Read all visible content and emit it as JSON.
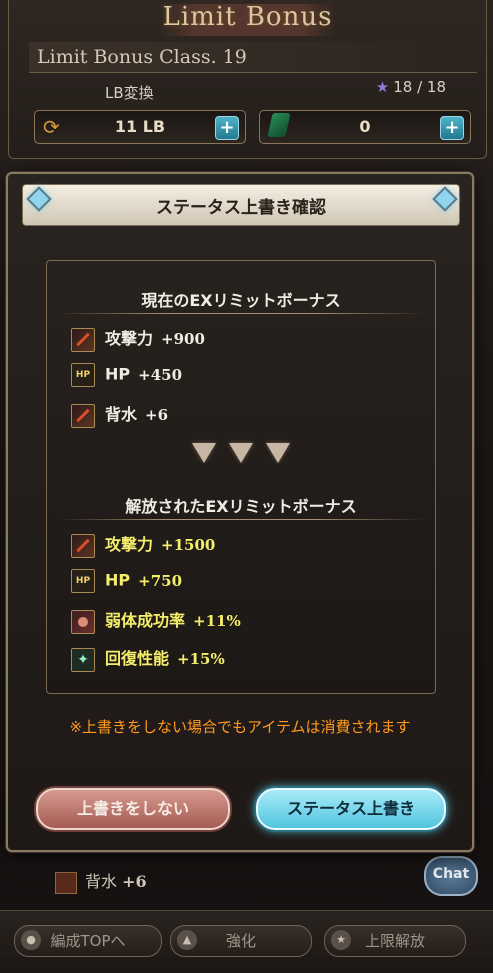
{
  "background": {
    "limit_bonus_title": "Limit Bonus",
    "class_label": "Limit Bonus Class. 19",
    "lb_convert_label": "LB変換",
    "star_count": "18 / 18",
    "lb_points": "11 LB",
    "gem_count": "0",
    "under_stat_label": "背水",
    "under_stat_value": "+6",
    "chat_label": "Chat",
    "nav": {
      "party_top": "編成TOPへ",
      "enhance": "強化",
      "uncap": "上限解放"
    }
  },
  "dialog": {
    "title": "ステータス上書き確認",
    "current_section_title": "現在のEXリミットボーナス",
    "current_stats": [
      {
        "icon": "attack-icon",
        "label": "攻撃力",
        "value": "+900"
      },
      {
        "icon": "hp-icon",
        "label": "HP",
        "value": "+450"
      },
      {
        "icon": "attack-icon",
        "label": "背水",
        "value": "+6"
      }
    ],
    "released_section_title": "解放されたEXリミットボーナス",
    "released_stats": [
      {
        "icon": "attack-icon",
        "label": "攻撃力",
        "value": "+1500"
      },
      {
        "icon": "hp-icon",
        "label": "HP",
        "value": "+750"
      },
      {
        "icon": "debuff-icon",
        "label": "弱体成功率",
        "value": "+11%"
      },
      {
        "icon": "heal-icon",
        "label": "回復性能",
        "value": "+15%"
      }
    ],
    "notice": "※上書きをしない場合でもアイテムは消費されます",
    "cancel_button": "上書きをしない",
    "confirm_button": "ステータス上書き"
  },
  "colors": {
    "notice": "#ff9a1e",
    "released_stat_text": "#f5ee6a",
    "confirm_button": "#51c4df",
    "cancel_button": "#a45b52"
  }
}
